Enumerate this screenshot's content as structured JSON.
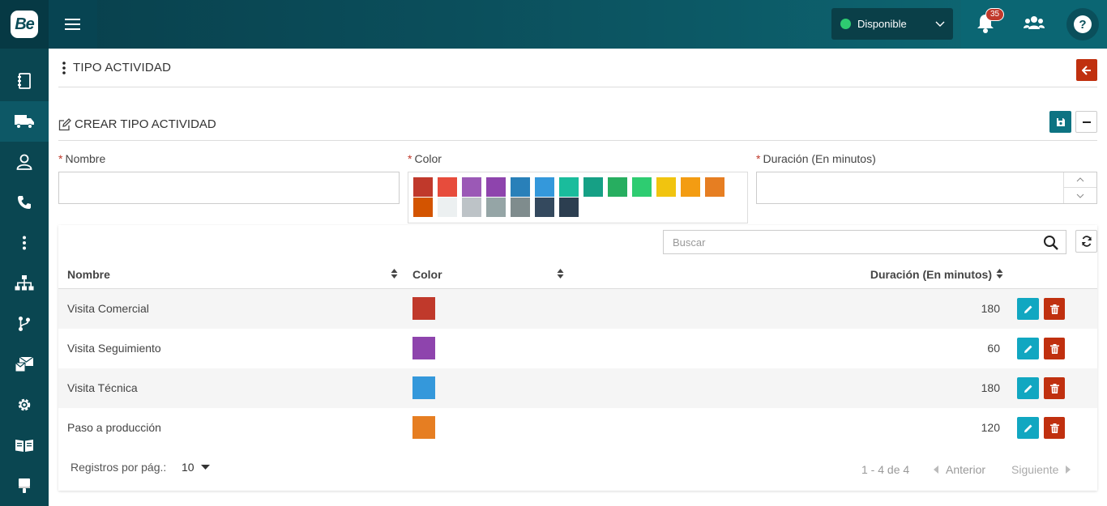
{
  "header": {
    "logo_text": "Be",
    "status_label": "Disponible",
    "notification_count": "35"
  },
  "page": {
    "title": "TIPO ACTIVIDAD",
    "section_title": "CREAR TIPO ACTIVIDAD"
  },
  "form": {
    "name_label": "Nombre",
    "color_label": "Color",
    "duration_label": "Duración (En minutos)",
    "required_mark": "*",
    "palette": [
      "#c0392b",
      "#e74c3c",
      "#9b59b6",
      "#8e44ad",
      "#2980b9",
      "#3498db",
      "#1abc9c",
      "#16a085",
      "#27ae60",
      "#2ecc71",
      "#f1c40f",
      "#f39c12",
      "#e67e22",
      "#d35400",
      "#ecf0f1",
      "#bdc3c7",
      "#95a5a6",
      "#7f8c8d",
      "#34495e",
      "#2c3e50"
    ]
  },
  "table": {
    "search_placeholder": "Buscar",
    "columns": {
      "name": "Nombre",
      "color": "Color",
      "duration": "Duración (En minutos)"
    },
    "rows": [
      {
        "name": "Visita Comercial",
        "color": "#c0392b",
        "duration": "180"
      },
      {
        "name": "Visita Seguimiento",
        "color": "#8e44ad",
        "duration": "60"
      },
      {
        "name": "Visita Técnica",
        "color": "#3498db",
        "duration": "180"
      },
      {
        "name": "Paso a producción",
        "color": "#e67e22",
        "duration": "120"
      }
    ]
  },
  "pager": {
    "per_page_label": "Registros por pág.:",
    "per_page_value": "10",
    "info": "1 - 4 de 4",
    "prev": "Anterior",
    "next": "Siguiente"
  }
}
